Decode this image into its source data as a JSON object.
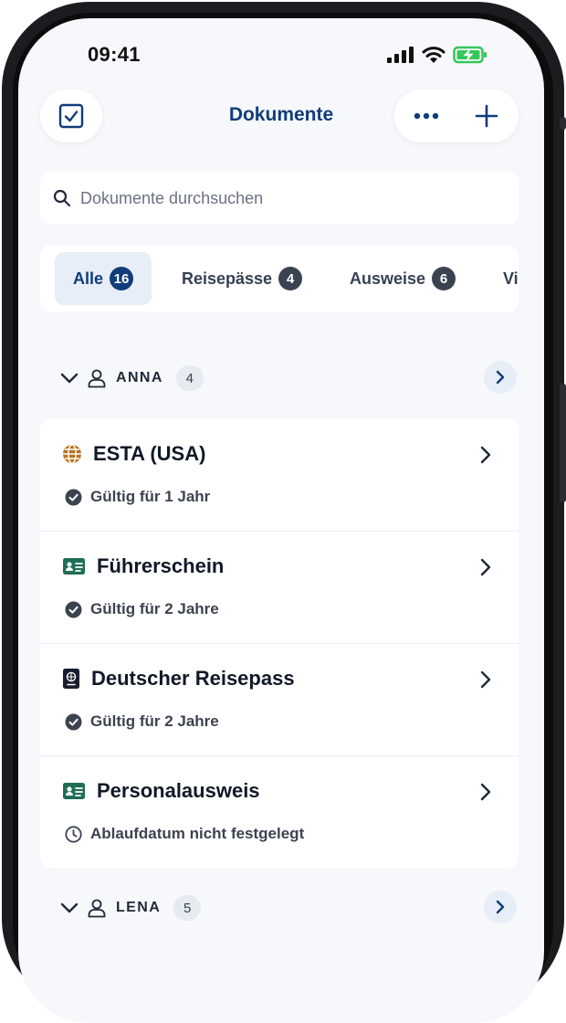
{
  "status_bar": {
    "time": "09:41"
  },
  "header": {
    "title": "Dokumente"
  },
  "search": {
    "placeholder": "Dokumente durchsuchen"
  },
  "tabs": [
    {
      "label": "Alle",
      "count": "16",
      "active": true
    },
    {
      "label": "Reisepässe",
      "count": "4"
    },
    {
      "label": "Ausweise",
      "count": "6"
    },
    {
      "label": "Vi"
    }
  ],
  "groups": [
    {
      "name": "ANNA",
      "count": "4",
      "documents": [
        {
          "title": "ESTA (USA)",
          "status": "Gültig für 1 Jahr",
          "icon": "globe-icon",
          "status_icon": "check-circle-icon"
        },
        {
          "title": "Führerschein",
          "status": "Gültig für 2 Jahre",
          "icon": "id-card-icon",
          "status_icon": "check-circle-icon"
        },
        {
          "title": "Deutscher Reisepass",
          "status": "Gültig für 2 Jahre",
          "icon": "passport-icon",
          "status_icon": "check-circle-icon"
        },
        {
          "title": "Personalausweis",
          "status": "Ablaufdatum nicht festgelegt",
          "icon": "id-card-icon",
          "status_icon": "clock-icon"
        }
      ]
    },
    {
      "name": "LENA",
      "count": "5"
    }
  ],
  "colors": {
    "accent": "#103c7a",
    "background": "#f6f8fb",
    "card": "#ffffff",
    "globe": "#b7741f",
    "id_card": "#1f6e55",
    "badge": "#3c4350"
  }
}
